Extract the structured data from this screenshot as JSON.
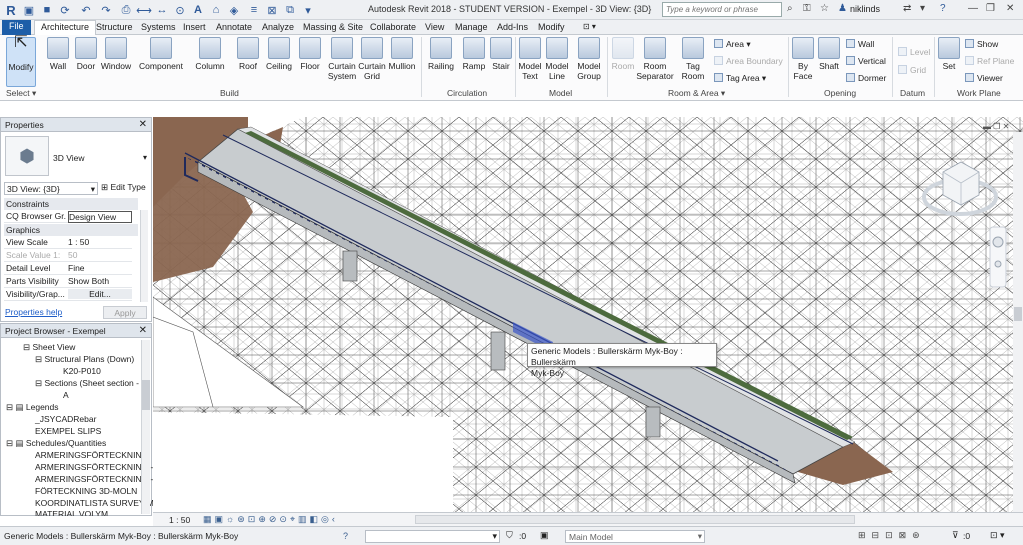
{
  "titlebar": {
    "title": "Autodesk Revit 2018 - STUDENT VERSION -    Exempel - 3D View: {3D}",
    "search_placeholder": "Type a keyword or phrase",
    "user": "niklinds"
  },
  "tabs": [
    "File",
    "Architecture",
    "Structure",
    "Systems",
    "Insert",
    "Annotate",
    "Analyze",
    "Massing & Site",
    "Collaborate",
    "View",
    "Manage",
    "Add-Ins",
    "Modify"
  ],
  "ribbon": {
    "tools": [
      "Modify",
      "Wall",
      "Door",
      "Window",
      "Component",
      "Column",
      "Roof",
      "Ceiling",
      "Floor",
      "Curtain System",
      "Curtain Grid",
      "Mullion",
      "Railing",
      "Ramp",
      "Stair",
      "Model Text",
      "Model Line",
      "Model Group",
      "Room",
      "Room Separator",
      "Tag Room",
      "By Face",
      "Shaft",
      "Set"
    ],
    "small": {
      "area": "Area",
      "area_boundary": "Area  Boundary",
      "tag_area": "Tag  Area",
      "wall": "Wall",
      "vertical": "Vertical",
      "dormer": "Dormer",
      "level": "Level",
      "grid": "Grid",
      "show": "Show",
      "ref_plane": "Ref  Plane",
      "viewer": "Viewer"
    },
    "panels": {
      "select": "Select",
      "build": "Build",
      "circulation": "Circulation",
      "model": "Model",
      "room_area": "Room & Area",
      "opening": "Opening",
      "datum": "Datum",
      "work_plane": "Work Plane"
    }
  },
  "properties": {
    "header": "Properties",
    "type_name": "3D View",
    "view_selector": "3D View: {3D}",
    "edit_type": "Edit Type",
    "sec_constraints": "Constraints",
    "sec_graphics": "Graphics",
    "rows": [
      {
        "k": "CQ Browser Gr...",
        "v": "Design View"
      },
      {
        "k": "View Scale",
        "v": "1 : 50"
      },
      {
        "k": "Scale Value    1:",
        "v": "50"
      },
      {
        "k": "Detail Level",
        "v": "Fine"
      },
      {
        "k": "Parts Visibility",
        "v": "Show Both"
      },
      {
        "k": "Visibility/Grap...",
        "v": "Edit..."
      }
    ],
    "help": "Properties help",
    "apply": "Apply"
  },
  "browser": {
    "header": "Project Browser - Exempel",
    "items": [
      "Sheet View",
      "Structural Plans (Down)",
      "K20-P010",
      "Sections (Sheet section -",
      "A",
      "Legends",
      "_JSYCADRebar",
      "EXEMPEL SLIPS",
      "Schedules/Quantities",
      "ARMERINGSFÖRTECKNING",
      "ARMERINGSFÖRTECKNING -",
      "ARMERINGSFÖRTECKNING -",
      "FÖRTECKNING 3D-MOLN",
      "KOORDINATLISTA SURVEY M",
      "MATERIAL VOLYM"
    ]
  },
  "tooltip": {
    "line1": "Generic Models : Bullerskärm Myk-Boy : Bullerskärm",
    "line2": "Myk-Boy"
  },
  "viewbar": {
    "scale": "1 : 50"
  },
  "status": {
    "text": "Generic Models : Bullerskärm Myk-Boy : Bullerskärm Myk-Boy",
    "zero": ":0",
    "model": "Main Model",
    "filter": ":0"
  },
  "colors": {
    "accent": "#1d5ea8",
    "earth": "#8a6650",
    "deck": "#c8cccf",
    "rail": "#1f2a5c"
  }
}
